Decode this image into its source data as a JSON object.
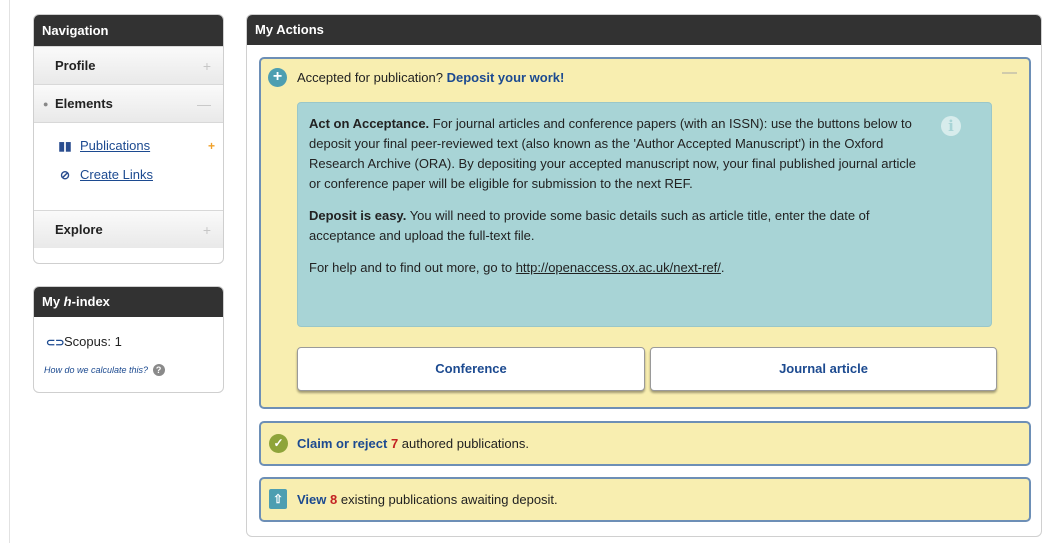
{
  "navigation": {
    "title": "Navigation",
    "items": [
      {
        "label": "Profile",
        "toggle": "+"
      },
      {
        "label": "Elements",
        "toggle": "—"
      },
      {
        "label": "Explore",
        "toggle": "+"
      }
    ],
    "sub_links": [
      {
        "label": "Publications",
        "icon": "books-icon",
        "badge": "+"
      },
      {
        "label": "Create Links",
        "icon": "link-icon"
      }
    ]
  },
  "hindex": {
    "title_prefix": "My ",
    "title_italic": "h",
    "title_suffix": "-index",
    "scopus": "Scopus: 1",
    "calc_link": "How do we calculate this?",
    "calc_icon": "?"
  },
  "actions": {
    "title": "My Actions",
    "accept": {
      "prefix": "Accepted for publication? ",
      "link": "Deposit your work!",
      "collapse": "—",
      "info": {
        "p1_bold": "Act on Acceptance.",
        "p1_text": " For journal articles and conference papers (with an ISSN): use the buttons below to deposit your final peer-reviewed text (also known as the 'Author Accepted Manuscript') in the Oxford Research Archive (ORA). By depositing your accepted manuscript now, your final published journal article or conference paper will be eligible for submission to the next REF.",
        "p2_bold": "Deposit is easy.",
        "p2_text": " You will need to provide some basic details such as article title, enter the date of acceptance and upload the full-text file.",
        "p3_text": "For help and to find out more, go to ",
        "p3_link": "http://openaccess.ox.ac.uk/next-ref/",
        "p3_end": "."
      },
      "buttons": {
        "conference": "Conference",
        "journal": "Journal article"
      }
    },
    "claim": {
      "link": "Claim or reject",
      "count": "7",
      "text": " authored publications."
    },
    "view": {
      "link": "View",
      "count": "8",
      "text": " existing publications awaiting deposit."
    }
  },
  "colors": {
    "header": "#323232",
    "accent_blue": "#1c4a90",
    "yellow": "#f8eeb0",
    "teal": "#a8d4d6",
    "count_red": "#c32222"
  }
}
